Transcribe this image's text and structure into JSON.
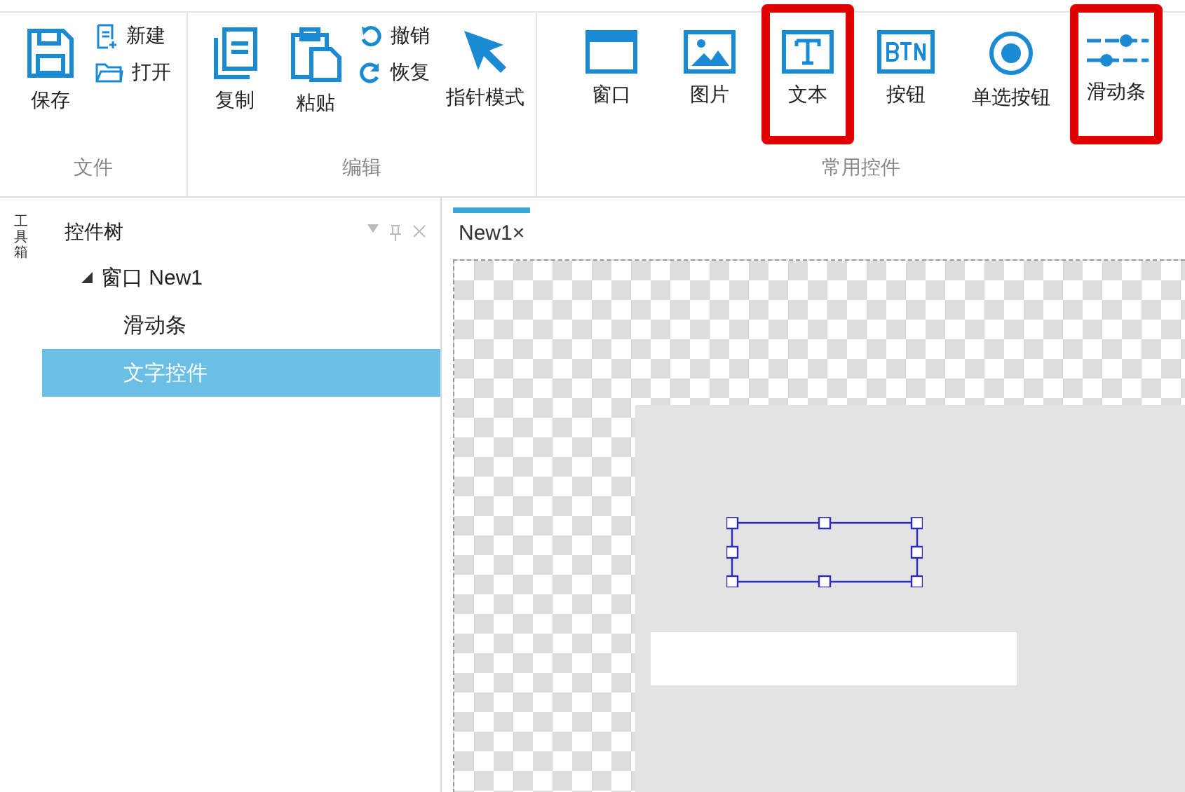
{
  "ribbon": {
    "groups": [
      {
        "label": "文件",
        "items": [
          {
            "label": "保存",
            "kind": "large",
            "highlighted": false
          },
          {
            "label": "新建",
            "kind": "small"
          },
          {
            "label": "打开",
            "kind": "small"
          }
        ]
      },
      {
        "label": "编辑",
        "items": [
          {
            "label": "复制",
            "kind": "large",
            "highlighted": false
          },
          {
            "label": "粘贴",
            "kind": "large",
            "highlighted": false
          },
          {
            "label": "撤销",
            "kind": "small"
          },
          {
            "label": "恢复",
            "kind": "small"
          },
          {
            "label": "指针模式",
            "kind": "large",
            "highlighted": false
          }
        ]
      },
      {
        "label": "常用控件",
        "items": [
          {
            "label": "窗口",
            "kind": "large",
            "highlighted": false
          },
          {
            "label": "图片",
            "kind": "large",
            "highlighted": false
          },
          {
            "label": "文本",
            "kind": "large",
            "highlighted": true
          },
          {
            "label": "按钮",
            "kind": "large",
            "highlighted": false
          },
          {
            "label": "单选按钮",
            "kind": "large",
            "highlighted": false
          },
          {
            "label": "滑动条",
            "kind": "large",
            "highlighted": true
          }
        ]
      }
    ]
  },
  "side_tab": {
    "label": "工具箱"
  },
  "panel": {
    "title": "控件树",
    "tree": [
      {
        "label": "窗口 New1",
        "expanded": true,
        "selected": false,
        "children": [
          {
            "label": "滑动条",
            "selected": false
          },
          {
            "label": "文字控件",
            "selected": true
          }
        ]
      }
    ]
  },
  "doc_tabs": [
    {
      "label": "New1",
      "close": "×",
      "selected": true
    }
  ]
}
